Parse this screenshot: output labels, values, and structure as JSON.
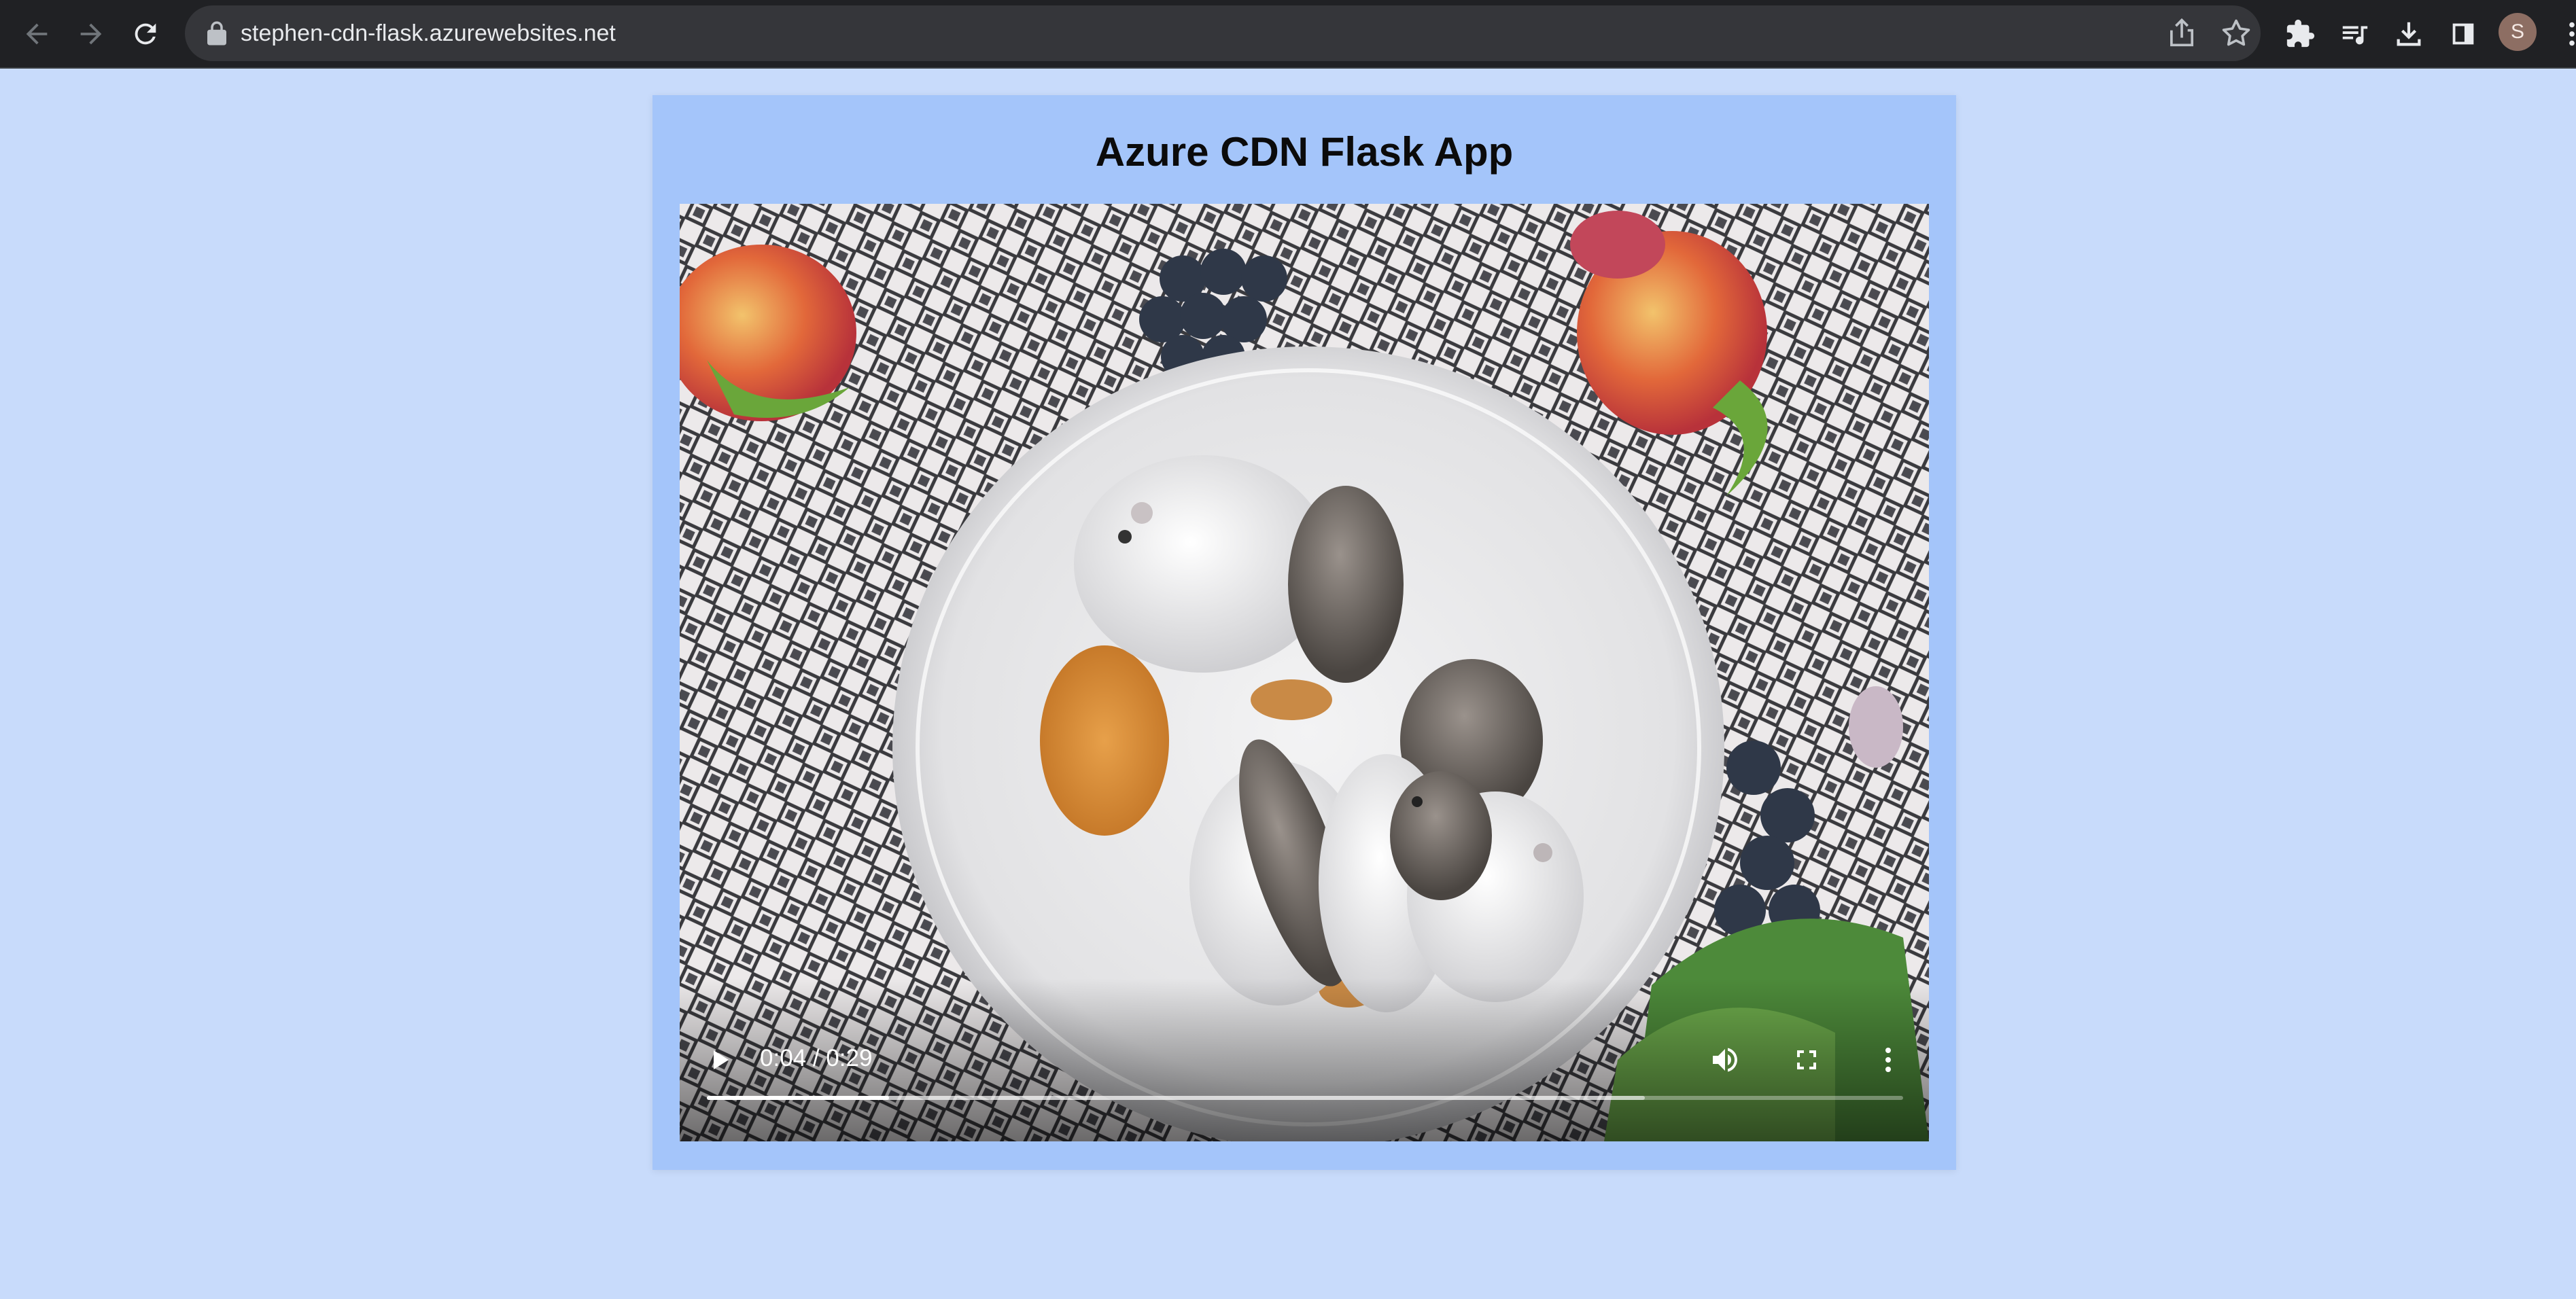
{
  "browser": {
    "url": "stephen-cdn-flask.azurewebsites.net",
    "profile_initial": "S",
    "icons": [
      "back-icon",
      "forward-icon",
      "reload-icon",
      "lock-icon",
      "share-icon",
      "bookmark-star-icon",
      "extensions-icon",
      "media-control-icon",
      "download-icon",
      "side-panel-icon",
      "menu-icon"
    ]
  },
  "page": {
    "title": "Azure CDN Flask App"
  },
  "video": {
    "time_display": "0:04 / 0:29",
    "current_time": "0:04",
    "duration": "0:29",
    "played_fraction": 0.152,
    "buffered_fraction": 0.784,
    "controls": [
      "play-icon",
      "volume-icon",
      "fullscreen-icon",
      "more-options-icon"
    ]
  },
  "colors": {
    "page_background": "#c8dbfb",
    "card_background": "#a4c5fa",
    "chrome_background": "#202124",
    "omnibox_background": "#35363a"
  }
}
